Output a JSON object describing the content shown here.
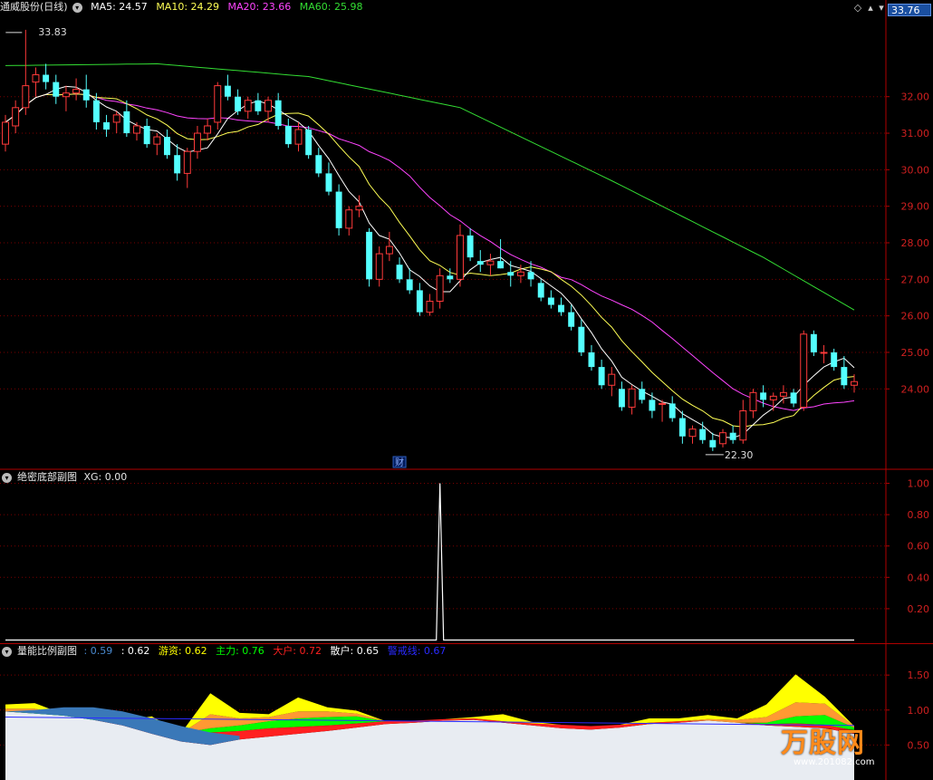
{
  "main": {
    "title": "通威股份(日线)",
    "indicators": [
      {
        "label": "MA5: 24.57",
        "color": "#ffffff"
      },
      {
        "label": "MA10: 24.29",
        "color": "#ffff55"
      },
      {
        "label": "MA20: 23.66",
        "color": "#ff44ff"
      },
      {
        "label": "MA60: 25.98",
        "color": "#33dd33"
      }
    ],
    "high_label": "33.83",
    "low_label": "22.30",
    "current_price": "33.76",
    "fin_label": "财"
  },
  "sub1": {
    "title": "绝密底部副图",
    "xg_label": "XG: 0.00"
  },
  "sub2": {
    "title": "量能比例副图",
    "indicators": [
      {
        "label": ": 0.59",
        "color": "#4a8ad0"
      },
      {
        "label": ": 0.62",
        "color": "#ffffff"
      },
      {
        "label": "游资: 0.62",
        "color": "#ffff00"
      },
      {
        "label": "主力: 0.76",
        "color": "#00ff00"
      },
      {
        "label": "大户: 0.72",
        "color": "#ff2020"
      },
      {
        "label": "散户: 0.65",
        "color": "#ffffff"
      },
      {
        "label": "警戒线: 0.67",
        "color": "#2020ff"
      }
    ]
  },
  "watermark": {
    "brand": "万股网",
    "url": "www.201082.com"
  },
  "colors": {
    "up": "#ff3a3a",
    "down": "#54ffff",
    "grid": "#7a0000",
    "axis": "#b00000",
    "ma5": "#ffffff",
    "ma10": "#ffff55",
    "ma20": "#ff44ff",
    "ma60": "#33dd33"
  },
  "chart_data": [
    {
      "type": "candlestick",
      "title": "通威股份(日线)",
      "y_ticks": [
        32.0,
        31.0,
        30.0,
        29.0,
        28.0,
        27.0,
        26.0,
        25.0,
        24.0
      ],
      "ylim": [
        21.8,
        34.2
      ],
      "annotations": [
        {
          "text": "33.83",
          "value": 33.83
        },
        {
          "text": "22.30",
          "value": 22.3
        }
      ],
      "ohlc": [
        [
          30.7,
          31.5,
          30.5,
          31.3
        ],
        [
          31.2,
          31.9,
          31.0,
          31.7
        ],
        [
          31.7,
          33.83,
          31.5,
          32.3
        ],
        [
          32.4,
          32.8,
          32.0,
          32.6
        ],
        [
          32.6,
          32.9,
          32.2,
          32.4
        ],
        [
          32.4,
          32.6,
          31.8,
          32.0
        ],
        [
          32.0,
          32.3,
          31.6,
          32.1
        ],
        [
          32.1,
          32.5,
          31.9,
          32.2
        ],
        [
          32.2,
          32.6,
          31.7,
          31.9
        ],
        [
          31.9,
          32.1,
          31.1,
          31.3
        ],
        [
          31.3,
          31.5,
          30.9,
          31.1
        ],
        [
          31.3,
          31.6,
          31.0,
          31.5
        ],
        [
          31.6,
          31.9,
          30.9,
          31.0
        ],
        [
          31.0,
          31.3,
          30.8,
          31.2
        ],
        [
          31.2,
          31.4,
          30.6,
          30.7
        ],
        [
          30.7,
          31.0,
          30.4,
          30.9
        ],
        [
          30.9,
          31.1,
          30.3,
          30.4
        ],
        [
          30.4,
          30.7,
          29.7,
          29.9
        ],
        [
          29.9,
          30.6,
          29.5,
          30.5
        ],
        [
          30.5,
          31.2,
          30.3,
          31.0
        ],
        [
          31.0,
          31.4,
          30.8,
          31.2
        ],
        [
          31.3,
          32.4,
          31.1,
          32.3
        ],
        [
          32.3,
          32.6,
          31.9,
          32.0
        ],
        [
          32.0,
          32.2,
          31.5,
          31.6
        ],
        [
          31.6,
          32.0,
          31.4,
          31.9
        ],
        [
          31.9,
          32.1,
          31.5,
          31.6
        ],
        [
          31.6,
          32.0,
          31.3,
          31.9
        ],
        [
          31.9,
          32.1,
          31.1,
          31.2
        ],
        [
          31.2,
          31.4,
          30.6,
          30.7
        ],
        [
          30.7,
          31.3,
          30.5,
          31.1
        ],
        [
          31.1,
          31.2,
          30.3,
          30.4
        ],
        [
          30.4,
          30.6,
          29.8,
          29.9
        ],
        [
          29.9,
          30.2,
          29.3,
          29.4
        ],
        [
          29.4,
          29.6,
          28.2,
          28.4
        ],
        [
          28.4,
          29.0,
          28.2,
          28.9
        ],
        [
          28.9,
          29.3,
          28.7,
          29.0
        ],
        [
          28.3,
          28.4,
          26.8,
          27.0
        ],
        [
          27.0,
          27.9,
          26.8,
          27.7
        ],
        [
          27.7,
          28.3,
          27.5,
          27.9
        ],
        [
          27.4,
          27.6,
          26.9,
          27.0
        ],
        [
          27.0,
          27.3,
          26.6,
          26.7
        ],
        [
          26.7,
          26.9,
          26.0,
          26.1
        ],
        [
          26.1,
          26.6,
          26.0,
          26.4
        ],
        [
          26.4,
          27.3,
          26.2,
          27.1
        ],
        [
          27.1,
          27.3,
          26.9,
          27.0
        ],
        [
          27.0,
          28.5,
          26.8,
          28.2
        ],
        [
          28.2,
          28.4,
          27.5,
          27.6
        ],
        [
          27.5,
          27.8,
          27.2,
          27.4
        ],
        [
          27.4,
          27.7,
          27.1,
          27.5
        ],
        [
          27.5,
          28.1,
          27.3,
          27.3
        ],
        [
          27.2,
          27.5,
          26.8,
          27.1
        ],
        [
          27.1,
          27.4,
          26.9,
          27.2
        ],
        [
          27.2,
          27.5,
          26.8,
          27.0
        ],
        [
          26.9,
          27.0,
          26.4,
          26.5
        ],
        [
          26.5,
          26.7,
          26.2,
          26.3
        ],
        [
          26.3,
          26.5,
          26.0,
          26.1
        ],
        [
          26.1,
          26.3,
          25.6,
          25.7
        ],
        [
          25.7,
          25.9,
          24.9,
          25.0
        ],
        [
          25.0,
          25.2,
          24.5,
          24.6
        ],
        [
          24.6,
          24.8,
          24.0,
          24.1
        ],
        [
          24.1,
          24.6,
          23.8,
          24.4
        ],
        [
          24.0,
          24.2,
          23.4,
          23.5
        ],
        [
          23.5,
          24.1,
          23.3,
          24.0
        ],
        [
          24.0,
          24.2,
          23.6,
          23.7
        ],
        [
          23.7,
          23.9,
          23.2,
          23.4
        ],
        [
          23.6,
          23.7,
          23.1,
          23.6
        ],
        [
          23.6,
          23.8,
          23.1,
          23.2
        ],
        [
          23.2,
          23.4,
          22.5,
          22.7
        ],
        [
          22.7,
          23.0,
          22.5,
          22.9
        ],
        [
          22.9,
          23.1,
          22.5,
          22.6
        ],
        [
          22.6,
          22.8,
          22.3,
          22.4
        ],
        [
          22.5,
          22.9,
          22.4,
          22.8
        ],
        [
          22.8,
          23.0,
          22.5,
          22.6
        ],
        [
          22.6,
          23.7,
          22.5,
          23.4
        ],
        [
          23.4,
          24.0,
          23.2,
          23.9
        ],
        [
          23.9,
          24.1,
          23.5,
          23.7
        ],
        [
          23.7,
          23.9,
          23.4,
          23.8
        ],
        [
          23.8,
          24.1,
          23.6,
          23.9
        ],
        [
          23.9,
          24.0,
          23.5,
          23.6
        ],
        [
          23.5,
          25.6,
          23.4,
          25.5
        ],
        [
          25.5,
          25.6,
          24.9,
          25.0
        ],
        [
          25.0,
          25.2,
          24.7,
          25.0
        ],
        [
          25.0,
          25.1,
          24.5,
          24.6
        ],
        [
          24.6,
          24.9,
          24.0,
          24.1
        ],
        [
          24.1,
          24.4,
          23.9,
          24.2
        ]
      ],
      "ma60_points": [
        [
          0,
          32.85
        ],
        [
          15,
          32.9
        ],
        [
          30,
          32.55
        ],
        [
          45,
          31.7
        ],
        [
          60,
          29.7
        ],
        [
          75,
          27.6
        ],
        [
          85,
          26.0
        ]
      ]
    },
    {
      "type": "line",
      "title": "绝密底部副图",
      "series_name": "XG",
      "y_ticks": [
        1.0,
        0.8,
        0.6,
        0.4,
        0.2
      ],
      "ylim": [
        -0.02,
        1.02
      ],
      "spike_index": 43,
      "spike_value": 1.0
    },
    {
      "type": "area",
      "title": "量能比例副图",
      "y_ticks": [
        1.5,
        1.0,
        0.5
      ],
      "ylim": [
        0,
        1.8
      ],
      "series": [
        {
          "name": "散户",
          "color": "#e8ecf2",
          "values": [
            0.98,
            0.95,
            0.92,
            0.86,
            0.78,
            0.66,
            0.55,
            0.5,
            0.58,
            0.62,
            0.66,
            0.7,
            0.75,
            0.8,
            0.82,
            0.85,
            0.86,
            0.82,
            0.78,
            0.74,
            0.72,
            0.75,
            0.8,
            0.82,
            0.85,
            0.82,
            0.78,
            0.76,
            0.74,
            0.66
          ]
        },
        {
          "name": "大户",
          "color": "#ff2020",
          "values": [
            0.0,
            0.0,
            0.0,
            0.0,
            0.02,
            0.05,
            0.1,
            0.18,
            0.12,
            0.12,
            0.1,
            0.08,
            0.06,
            0.04,
            0.03,
            0.02,
            0.02,
            0.02,
            0.03,
            0.05,
            0.05,
            0.04,
            0.02,
            0.02,
            0.0,
            0.0,
            0.02,
            0.05,
            0.05,
            0.05
          ]
        },
        {
          "name": "主力",
          "color": "#00ff00",
          "values": [
            0.0,
            0.02,
            0.02,
            0.04,
            0.0,
            0.0,
            0.02,
            0.06,
            0.08,
            0.1,
            0.12,
            0.12,
            0.1,
            0.0,
            0.0,
            0.0,
            0.0,
            0.0,
            0.0,
            0.0,
            0.0,
            0.0,
            0.0,
            0.0,
            0.0,
            0.0,
            0.02,
            0.1,
            0.14,
            0.04
          ]
        },
        {
          "name": "游资",
          "color": "#ff9933",
          "values": [
            0.04,
            0.05,
            0.0,
            0.02,
            0.0,
            0.1,
            0.0,
            0.2,
            0.1,
            0.06,
            0.1,
            0.08,
            0.04,
            0.0,
            0.0,
            0.0,
            0.0,
            0.0,
            0.0,
            0.0,
            0.0,
            0.0,
            0.0,
            0.0,
            0.02,
            0.04,
            0.08,
            0.2,
            0.16,
            0.02
          ]
        },
        {
          "name": "警戒线",
          "color": "#ffff00",
          "values": [
            0.06,
            0.08,
            0.0,
            0.06,
            0.04,
            0.1,
            0.0,
            0.3,
            0.08,
            0.04,
            0.2,
            0.06,
            0.04,
            0.0,
            0.0,
            0.0,
            0.02,
            0.1,
            0.02,
            0.0,
            0.0,
            0.0,
            0.06,
            0.04,
            0.06,
            0.02,
            0.18,
            0.4,
            0.1,
            0.0
          ]
        }
      ]
    }
  ]
}
